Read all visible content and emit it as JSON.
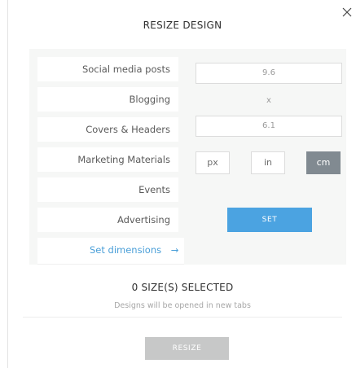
{
  "dialog": {
    "title": "RESIZE DESIGN",
    "close_icon": "close-icon"
  },
  "categories": [
    {
      "label": "Social media posts"
    },
    {
      "label": "Blogging"
    },
    {
      "label": "Covers & Headers"
    },
    {
      "label": "Marketing Materials"
    },
    {
      "label": "Events"
    },
    {
      "label": "Advertising"
    }
  ],
  "active_category": {
    "label": "Set dimensions",
    "arrow": "→"
  },
  "dimensions": {
    "width": "9.6",
    "separator": "x",
    "height": "6.1"
  },
  "units": [
    {
      "label": "px",
      "selected": false
    },
    {
      "label": "in",
      "selected": false
    },
    {
      "label": "cm",
      "selected": true
    }
  ],
  "set_button": "SET",
  "summary": {
    "selected": "0 SIZE(S) SELECTED",
    "note": "Designs will be opened in new tabs"
  },
  "resize_button": "RESIZE",
  "colors": {
    "accent": "#4ba3e1",
    "active_unit": "#818a91",
    "disabled_button": "#c7c8c8",
    "link": "#4a9fd8"
  }
}
